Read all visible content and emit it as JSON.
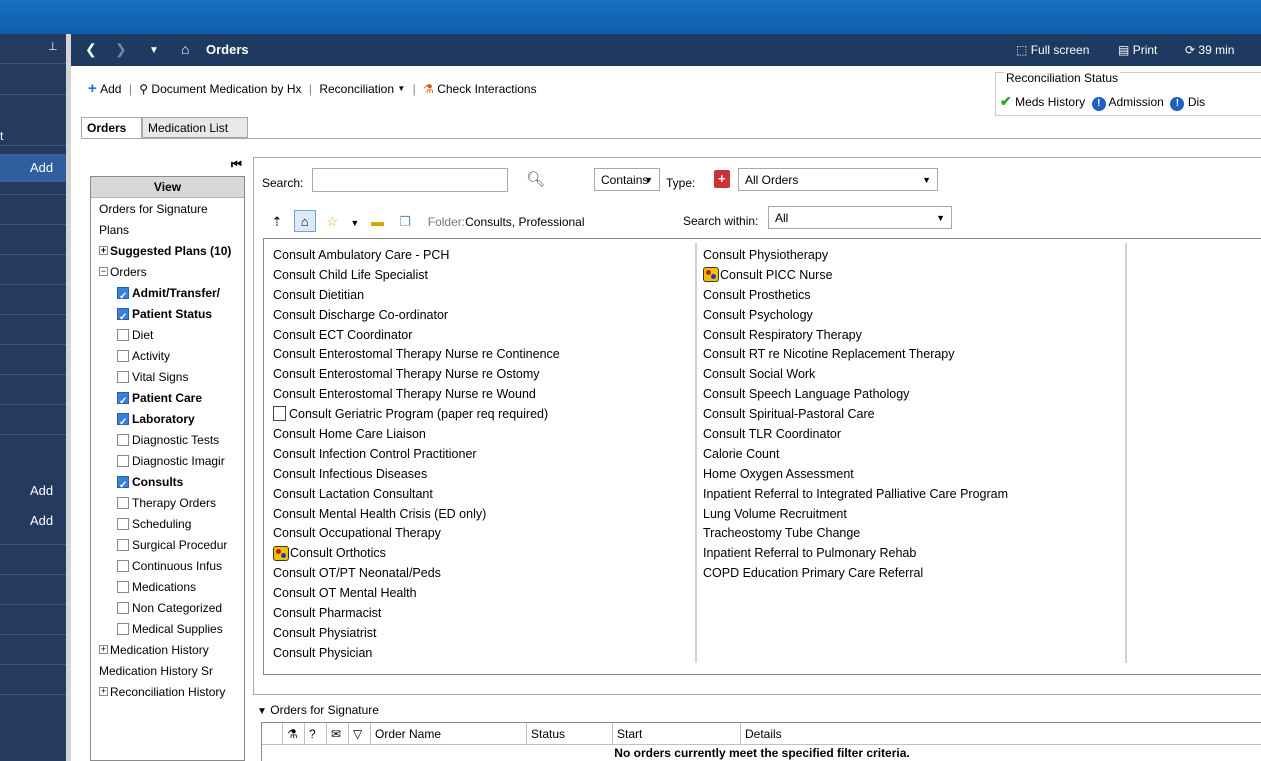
{
  "nav": {
    "title": "Orders",
    "full_screen": "Full screen",
    "print": "Print",
    "refresh": "39 min"
  },
  "leftrail": {
    "add1": "Add",
    "add2": "Add",
    "add3": "Add"
  },
  "toolbar": {
    "add": "Add",
    "document_med": "Document Medication by Hx",
    "reconciliation": "Reconciliation",
    "check_interactions": "Check Interactions"
  },
  "recon_status": {
    "legend": "Reconciliation Status",
    "meds_history": "Meds History",
    "admission": "Admission",
    "discharge": "Dis"
  },
  "tabs": [
    "Orders",
    "Medication List"
  ],
  "view": {
    "header": "View",
    "items": [
      {
        "label": "Orders for Signature",
        "type": "leaf",
        "bold": false
      },
      {
        "label": "Plans",
        "type": "leaf",
        "bold": false
      },
      {
        "label": "Suggested Plans (10)",
        "type": "expand",
        "bold": true
      },
      {
        "label": "Orders",
        "type": "collapse",
        "bold": false
      },
      {
        "label": "Admit/Transfer/",
        "type": "check",
        "checked": true,
        "bold": true
      },
      {
        "label": "Patient Status",
        "type": "check",
        "checked": true,
        "bold": true
      },
      {
        "label": "Diet",
        "type": "check",
        "checked": false,
        "bold": false
      },
      {
        "label": "Activity",
        "type": "check",
        "checked": false,
        "bold": false
      },
      {
        "label": "Vital Signs",
        "type": "check",
        "checked": false,
        "bold": false
      },
      {
        "label": "Patient Care",
        "type": "check",
        "checked": true,
        "bold": true
      },
      {
        "label": "Laboratory",
        "type": "check",
        "checked": true,
        "bold": true
      },
      {
        "label": "Diagnostic Tests",
        "type": "check",
        "checked": false,
        "bold": false
      },
      {
        "label": "Diagnostic Imagir",
        "type": "check",
        "checked": false,
        "bold": false
      },
      {
        "label": "Consults",
        "type": "check",
        "checked": true,
        "bold": true
      },
      {
        "label": "Therapy Orders",
        "type": "check",
        "checked": false,
        "bold": false
      },
      {
        "label": "Scheduling",
        "type": "check",
        "checked": false,
        "bold": false
      },
      {
        "label": "Surgical Procedur",
        "type": "check",
        "checked": false,
        "bold": false
      },
      {
        "label": "Continuous Infus",
        "type": "check",
        "checked": false,
        "bold": false
      },
      {
        "label": "Medications",
        "type": "check",
        "checked": false,
        "bold": false
      },
      {
        "label": "Non Categorized",
        "type": "check",
        "checked": false,
        "bold": false
      },
      {
        "label": "Medical Supplies",
        "type": "check",
        "checked": false,
        "bold": false
      },
      {
        "label": "Medication History",
        "type": "expand",
        "bold": false
      },
      {
        "label": "Medication History Sr",
        "type": "leaf",
        "bold": false
      },
      {
        "label": "Reconciliation History",
        "type": "expand",
        "bold": false
      }
    ]
  },
  "search": {
    "label": "Search:",
    "value": "",
    "mode": "Contains",
    "type_label": "Type:",
    "type_value": "All Orders",
    "folder_label": "Folder:",
    "folder_value": "Consults, Professional",
    "within_label": "Search within:",
    "within_value": "All"
  },
  "orders_col1": [
    {
      "label": "Consult Ambulatory Care - PCH"
    },
    {
      "label": "Consult Child Life Specialist"
    },
    {
      "label": "Consult Dietitian"
    },
    {
      "label": "Consult Discharge Co-ordinator"
    },
    {
      "label": "Consult ECT Coordinator"
    },
    {
      "label": "Consult Enterostomal Therapy Nurse re Continence"
    },
    {
      "label": "Consult Enterostomal Therapy Nurse re Ostomy"
    },
    {
      "label": "Consult Enterostomal Therapy Nurse re Wound"
    },
    {
      "label": "Consult Geriatric Program (paper req required)",
      "icon": "document-icon"
    },
    {
      "label": "Consult Home Care Liaison"
    },
    {
      "label": "Consult Infection Control Practitioner"
    },
    {
      "label": "Consult Infectious Diseases"
    },
    {
      "label": "Consult Lactation Consultant"
    },
    {
      "label": "Consult Mental Health Crisis (ED only)"
    },
    {
      "label": "Consult Occupational Therapy"
    },
    {
      "label": "Consult Orthotics",
      "icon": "plan-badge-icon"
    },
    {
      "label": "Consult OT/PT Neonatal/Peds"
    },
    {
      "label": "Consult OT Mental Health"
    },
    {
      "label": "Consult Pharmacist"
    },
    {
      "label": "Consult Physiatrist"
    },
    {
      "label": "Consult Physician"
    }
  ],
  "orders_col2": [
    {
      "label": "Consult Physiotherapy"
    },
    {
      "label": "Consult PICC Nurse",
      "icon": "plan-badge-icon"
    },
    {
      "label": "Consult Prosthetics"
    },
    {
      "label": "Consult Psychology"
    },
    {
      "label": "Consult Respiratory Therapy"
    },
    {
      "label": "Consult RT re Nicotine Replacement Therapy"
    },
    {
      "label": "Consult Social Work"
    },
    {
      "label": "Consult Speech Language Pathology"
    },
    {
      "label": "Consult Spiritual-Pastoral Care"
    },
    {
      "label": "Consult TLR Coordinator"
    },
    {
      "label": "Calorie Count"
    },
    {
      "label": "Home Oxygen Assessment"
    },
    {
      "label": "Inpatient Referral to Integrated Palliative Care Program"
    },
    {
      "label": "Lung Volume Recruitment"
    },
    {
      "label": "Tracheostomy Tube Change"
    },
    {
      "label": "Inpatient Referral to Pulmonary Rehab"
    },
    {
      "label": "COPD Education Primary Care Referral"
    }
  ],
  "signature": {
    "title": "Orders for Signature",
    "columns": [
      "Order Name",
      "Status",
      "Start",
      "Details"
    ],
    "empty": "No orders currently meet the specified filter criteria."
  }
}
